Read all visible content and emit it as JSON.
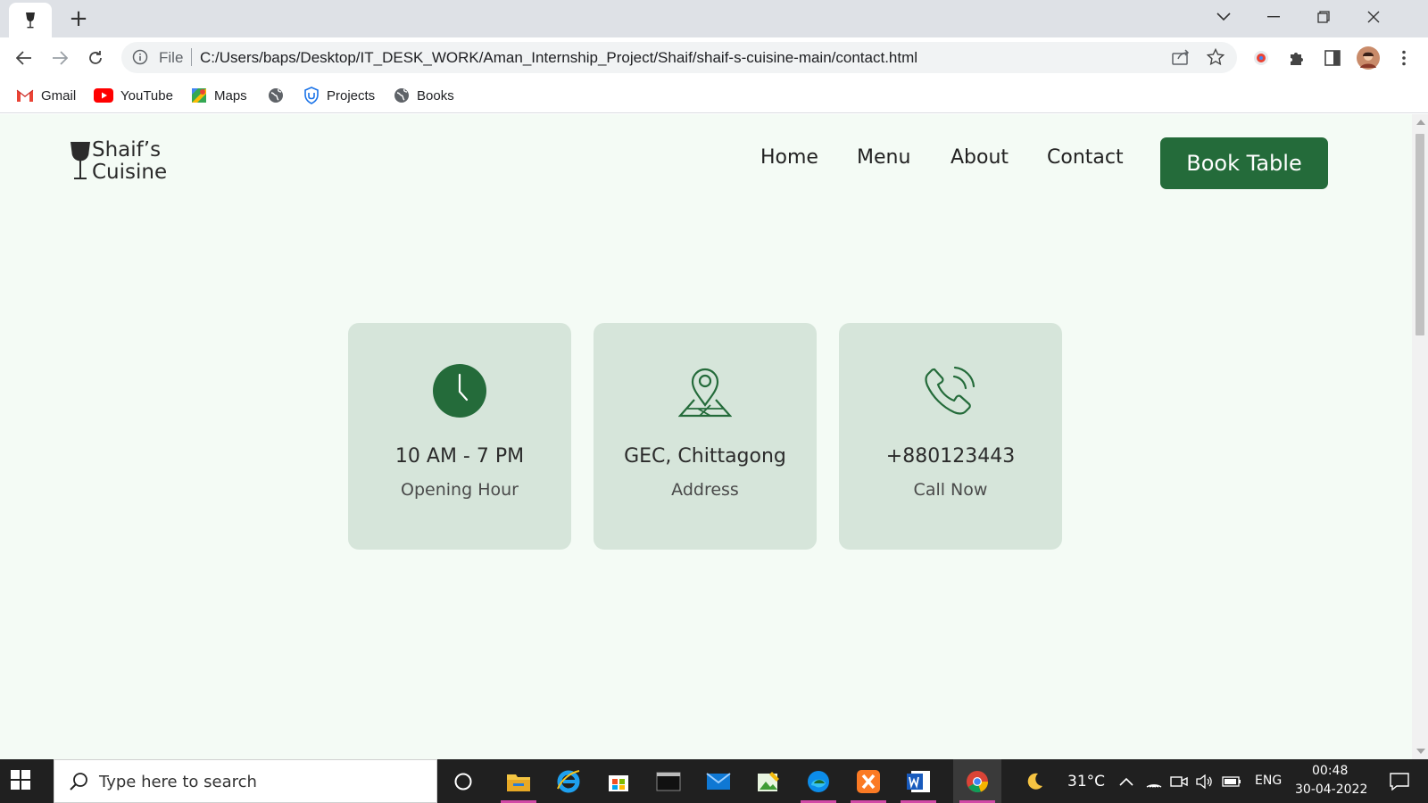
{
  "browser": {
    "tab_favicon": "wine-glass-icon",
    "new_tab_label": "+",
    "omnibox": {
      "scheme_label": "File",
      "url": "C:/Users/baps/Desktop/IT_DESK_WORK/Aman_Internship_Project/Shaif/shaif-s-cuisine-main/contact.html"
    },
    "bookmarks": [
      {
        "label": "Gmail",
        "icon": "gmail-icon"
      },
      {
        "label": "YouTube",
        "icon": "youtube-icon"
      },
      {
        "label": "Maps",
        "icon": "maps-icon"
      },
      {
        "label": "",
        "icon": "globe-icon"
      },
      {
        "label": "Projects",
        "icon": "shield-icon"
      },
      {
        "label": "Books",
        "icon": "globe-icon"
      }
    ]
  },
  "site": {
    "logo": {
      "line1": "Shaif’s",
      "line2": "Cuisine"
    },
    "nav": {
      "home": "Home",
      "menu": "Menu",
      "about": "About",
      "contact": "Contact"
    },
    "book_button": "Book Table",
    "accent_color": "#246b3a",
    "cards": [
      {
        "icon": "clock-icon",
        "title": "10 AM - 7 PM",
        "subtitle": "Opening Hour"
      },
      {
        "icon": "map-pin-icon",
        "title": "GEC, Chittagong",
        "subtitle": "Address"
      },
      {
        "icon": "phone-icon",
        "title": "+880123443",
        "subtitle": "Call Now"
      }
    ]
  },
  "taskbar": {
    "search_placeholder": "Type here to search",
    "weather": "31°C",
    "language": "ENG",
    "time": "00:48",
    "date": "30-04-2022"
  }
}
